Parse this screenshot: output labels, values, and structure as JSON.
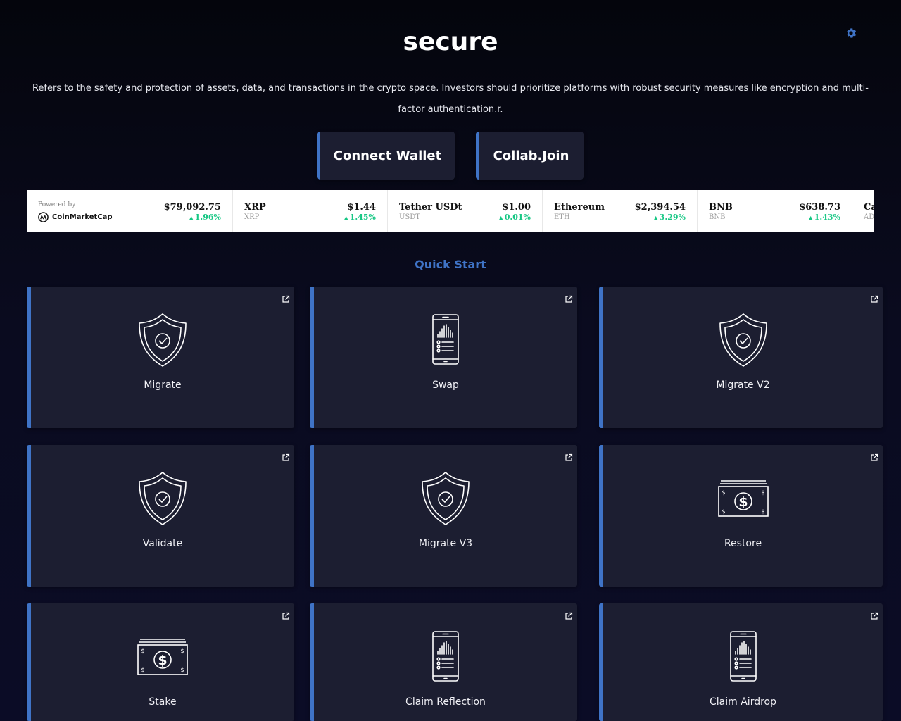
{
  "header": {
    "title": "secure",
    "description": "Refers to the safety and protection of assets, data, and transactions in the crypto space. Investors should prioritize platforms with robust security measures like encryption and multi-factor authentication.r."
  },
  "buttons": {
    "connect_wallet": "Connect Wallet",
    "collab_join": "Collab.Join"
  },
  "ticker": {
    "powered_by": "Powered by",
    "brand": "CoinMarketCap",
    "items": [
      {
        "name": "",
        "symbol": "",
        "price": "$79,092.75",
        "change": "1.96%"
      },
      {
        "name": "XRP",
        "symbol": "XRP",
        "price": "$1.44",
        "change": "1.45%"
      },
      {
        "name": "Tether USDt",
        "symbol": "USDT",
        "price": "$1.00",
        "change": "0.01%"
      },
      {
        "name": "Ethereum",
        "symbol": "ETH",
        "price": "$2,394.54",
        "change": "3.29%"
      },
      {
        "name": "BNB",
        "symbol": "BNB",
        "price": "$638.73",
        "change": "1.43%"
      },
      {
        "name": "Ca",
        "symbol": "AD",
        "price": "",
        "change": ""
      }
    ]
  },
  "quick_start": {
    "title": "Quick Start",
    "cards": [
      {
        "label": "Migrate",
        "icon": "shield-check-icon"
      },
      {
        "label": "Swap",
        "icon": "mobile-chart-icon"
      },
      {
        "label": "Migrate V2",
        "icon": "shield-check-icon"
      },
      {
        "label": "Validate",
        "icon": "shield-check-icon"
      },
      {
        "label": "Migrate V3",
        "icon": "shield-check-icon"
      },
      {
        "label": "Restore",
        "icon": "banknote-icon"
      },
      {
        "label": "Stake",
        "icon": "banknote-icon"
      },
      {
        "label": "Claim Reflection",
        "icon": "mobile-chart-icon"
      },
      {
        "label": "Claim Airdrop",
        "icon": "mobile-chart-icon"
      }
    ]
  },
  "colors": {
    "accent": "#3f73c6",
    "card_bg": "#1c1e31",
    "positive": "#16c784"
  }
}
